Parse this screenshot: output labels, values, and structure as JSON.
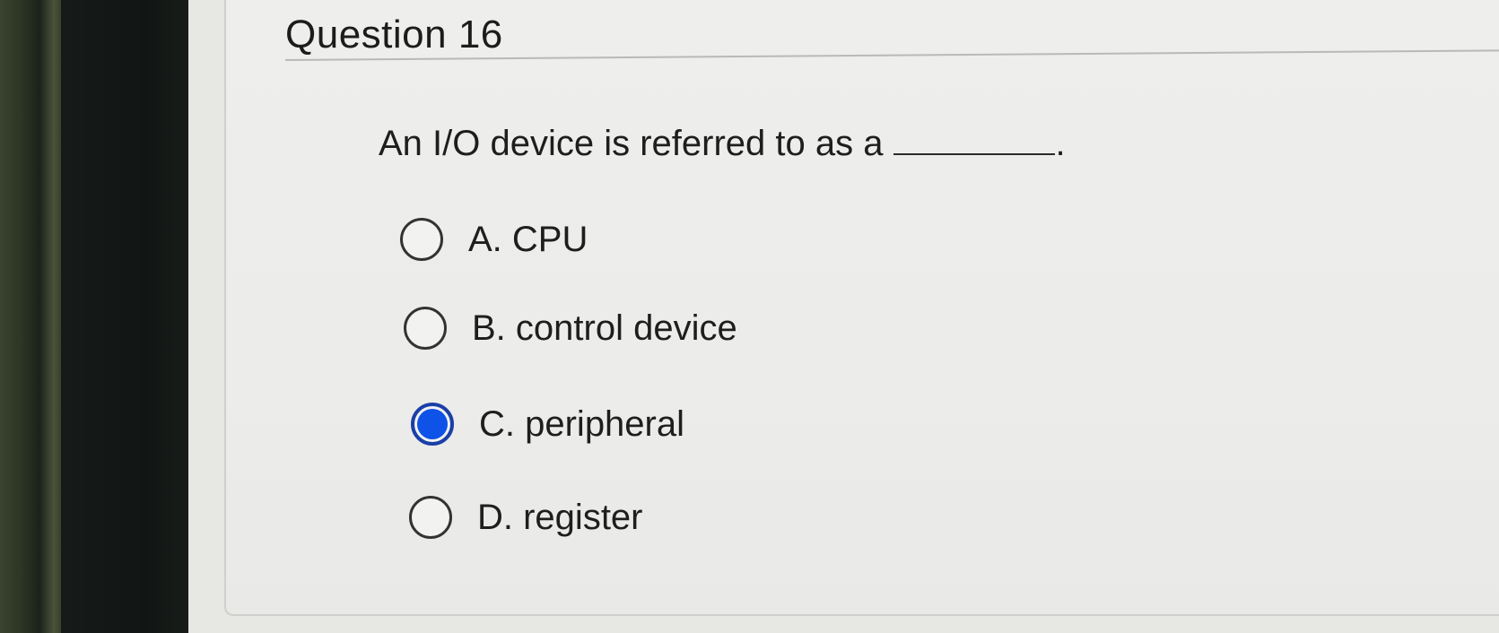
{
  "question": {
    "title": "Question 16",
    "prompt": "An I/O device is referred to as a",
    "prompt_end": "."
  },
  "options": [
    {
      "label": "A. CPU",
      "selected": false
    },
    {
      "label": "B. control device",
      "selected": false
    },
    {
      "label": "C. peripheral",
      "selected": true
    },
    {
      "label": "D. register",
      "selected": false
    }
  ],
  "colors": {
    "selected_accent": "#0f52e8",
    "text": "#1e1e1e"
  }
}
